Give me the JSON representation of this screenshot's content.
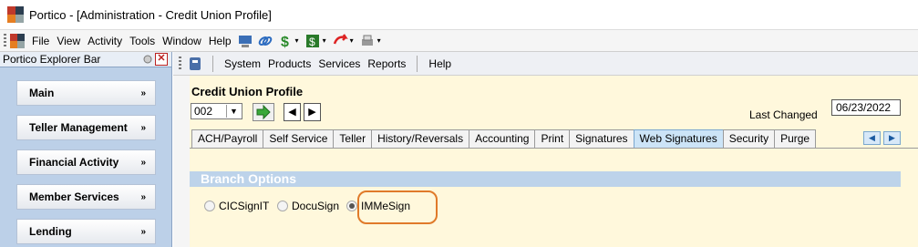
{
  "window": {
    "title": "Portico - [Administration - Credit Union Profile]"
  },
  "menubar": {
    "items": [
      "File",
      "View",
      "Activity",
      "Tools",
      "Window",
      "Help"
    ]
  },
  "toolbar_icons": [
    "network-icon",
    "link-icon",
    "dollar-icon",
    "cash-icon",
    "undo-arrow-icon",
    "printer-icon"
  ],
  "sidebar": {
    "title": "Portico Explorer Bar",
    "groups": [
      "Main",
      "Teller Management",
      "Financial Activity",
      "Member Services",
      "Lending"
    ]
  },
  "content_toolbar": {
    "items": [
      "System",
      "Products",
      "Services",
      "Reports"
    ],
    "help": "Help"
  },
  "profile": {
    "title": "Credit Union Profile",
    "selected": "002",
    "last_changed_label": "Last Changed",
    "last_changed": "06/23/2022"
  },
  "tabs": [
    "ACH/Payroll",
    "Self Service",
    "Teller",
    "History/Reversals",
    "Accounting",
    "Print",
    "Signatures",
    "Web Signatures",
    "Security",
    "Purge"
  ],
  "active_tab": "Web Signatures",
  "branch_options": {
    "header": "Branch Options",
    "options": [
      "CICSignIT",
      "DocuSign",
      "IMMeSign"
    ],
    "selected": "IMMeSign"
  },
  "colors": {
    "accent_tab": "#cce4f7",
    "panel_bg": "#fff8dc",
    "highlight": "#e07a2a"
  }
}
